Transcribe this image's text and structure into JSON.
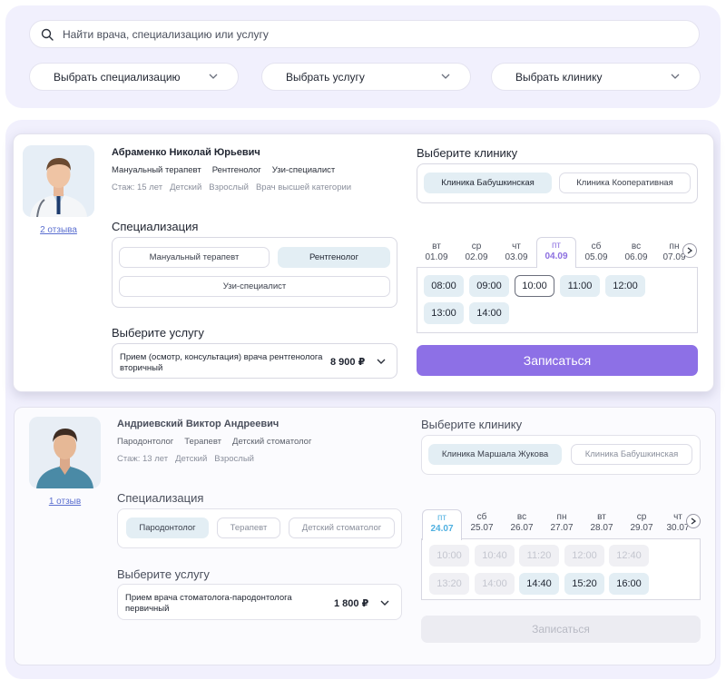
{
  "search": {
    "placeholder": "Найти врача, специализацию или услугу"
  },
  "filters": [
    {
      "label": "Выбрать специализацию"
    },
    {
      "label": "Выбрать услугу"
    },
    {
      "label": "Выбрать клинику"
    }
  ],
  "doctors": [
    {
      "name": "Абраменко Николай Юрьевич",
      "reviews": "2 отзыва",
      "specialties": [
        "Мануальный терапевт",
        "Рентгенолог",
        "Узи-специалист"
      ],
      "experience": [
        "Стаж: 15 лет",
        "Детский",
        "Взрослый",
        "Врач высшей категории"
      ],
      "specialization_title": "Специализация",
      "specialization_chips": [
        "Мануальный терапевт",
        "Рентгенолог",
        "Узи-специалист"
      ],
      "specialization_selected": "Рентгенолог",
      "service_title": "Выберите услугу",
      "service_name": "Прием (осмотр, консультация) врача рентгенолога вторичный",
      "service_price": "8 900 ₽",
      "clinic_title": "Выберите клинику",
      "clinics": [
        "Клиника Бабушкинская",
        "Клиника Кооперативная"
      ],
      "clinic_selected": "Клиника Бабушкинская",
      "days": [
        {
          "wd": "вт",
          "date": "01.09"
        },
        {
          "wd": "ср",
          "date": "02.09"
        },
        {
          "wd": "чт",
          "date": "03.09"
        },
        {
          "wd": "пт",
          "date": "04.09",
          "active": true
        },
        {
          "wd": "сб",
          "date": "05.09"
        },
        {
          "wd": "вс",
          "date": "06.09"
        },
        {
          "wd": "пн",
          "date": "07.09"
        }
      ],
      "slots": [
        {
          "time": "08:00",
          "state": "available"
        },
        {
          "time": "09:00",
          "state": "available"
        },
        {
          "time": "10:00",
          "state": "selected"
        },
        {
          "time": "11:00",
          "state": "available"
        },
        {
          "time": "12:00",
          "state": "available"
        },
        {
          "time": "13:00",
          "state": "available"
        },
        {
          "time": "14:00",
          "state": "available"
        }
      ],
      "book_label": "Записаться"
    },
    {
      "name": "Андриевский Виктор Андреевич",
      "reviews": "1 отзыв",
      "specialties": [
        "Пародонтолог",
        "Терапевт",
        "Детский стоматолог"
      ],
      "experience": [
        "Стаж: 13 лет",
        "Детский",
        "Взрослый"
      ],
      "specialization_title": "Специализация",
      "specialization_chips": [
        "Пародонтолог",
        "Терапевт",
        "Детский стоматолог"
      ],
      "specialization_selected": "Пародонтолог",
      "service_title": "Выберите услугу",
      "service_name": "Прием врача стоматолога-пародонтолога первичный",
      "service_price": "1 800 ₽",
      "clinic_title": "Выберите клинику",
      "clinics": [
        "Клиника Маршала Жукова",
        "Клиника Бабушкинская"
      ],
      "clinic_selected": "Клиника Маршала Жукова",
      "days": [
        {
          "wd": "пт",
          "date": "24.07",
          "active": true
        },
        {
          "wd": "сб",
          "date": "25.07"
        },
        {
          "wd": "вс",
          "date": "26.07"
        },
        {
          "wd": "пн",
          "date": "27.07"
        },
        {
          "wd": "вт",
          "date": "28.07"
        },
        {
          "wd": "ср",
          "date": "29.07"
        },
        {
          "wd": "чт",
          "date": "30.07"
        }
      ],
      "slots": [
        {
          "time": "10:00",
          "state": "disabled"
        },
        {
          "time": "10:40",
          "state": "disabled"
        },
        {
          "time": "11:20",
          "state": "disabled"
        },
        {
          "time": "12:00",
          "state": "disabled"
        },
        {
          "time": "12:40",
          "state": "disabled"
        },
        {
          "time": "13:20",
          "state": "disabled"
        },
        {
          "time": "14:00",
          "state": "disabled"
        },
        {
          "time": "14:40",
          "state": "available"
        },
        {
          "time": "15:20",
          "state": "available"
        },
        {
          "time": "16:00",
          "state": "available"
        }
      ],
      "book_label": "Записаться",
      "book_disabled": true
    }
  ],
  "colors": {
    "accent": "#8d70e6",
    "chip_active": "#e3eef4",
    "panel": "#f1f0fd",
    "link": "#5b6fd0"
  }
}
